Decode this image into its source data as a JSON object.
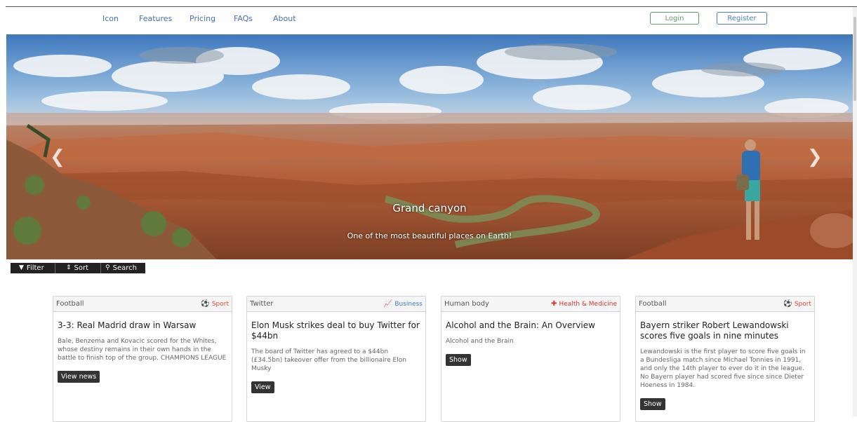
{
  "nav": {
    "links": [
      "Icon",
      "Features",
      "Pricing",
      "FAQs",
      "About"
    ],
    "login": "Login",
    "register": "Register"
  },
  "hero": {
    "title": "Grand canyon",
    "subtitle": "One of the most beautiful places on Earth!",
    "prev_icon": "chevron-left-icon",
    "next_icon": "chevron-right-icon"
  },
  "toolbar": {
    "filter": "Filter",
    "sort": "Sort",
    "search": "Search"
  },
  "cards": [
    {
      "category": "Football",
      "tag": "Sport",
      "tag_icon": "soccer-ball-icon",
      "tag_color": "#e0493b",
      "title": "3-3: Real Madrid draw in Warsaw",
      "text": "Bale, Benzema and Kovacic scored for the Whites, whose destiny remains in their own hands in the battle to finish top of the group. CHAMPIONS LEAGUE",
      "button": "View news"
    },
    {
      "category": "Twitter",
      "tag": "Business",
      "tag_icon": "line-chart-icon",
      "tag_color": "#3b7fc4",
      "title": "Elon Musk strikes deal to buy Twitter for $44bn",
      "text": "The board of Twitter has agreed to a $44bn (£34.5bn) takeover offer from the billionaire Elon Musky",
      "button": "View"
    },
    {
      "category": "Human body",
      "tag": "Health & Medicine",
      "tag_icon": "medkit-icon",
      "tag_color": "#d9352f",
      "title": "Alcohol and the Brain: An Overview",
      "text": "Alcohol and the Brain",
      "button": "Show"
    },
    {
      "category": "Football",
      "tag": "Sport",
      "tag_icon": "soccer-ball-icon",
      "tag_color": "#e0493b",
      "title": "Bayern striker Robert Lewandowski scores five goals in nine minutes",
      "text": "Lewandowski is the first player to score five goals in a Bundesliga match since Michael Tonnies in 1991, and only the 14th player to ever do it in the league. No Bayern player had scored five since since Dieter Hoeness in 1984.",
      "button": "Show"
    }
  ]
}
